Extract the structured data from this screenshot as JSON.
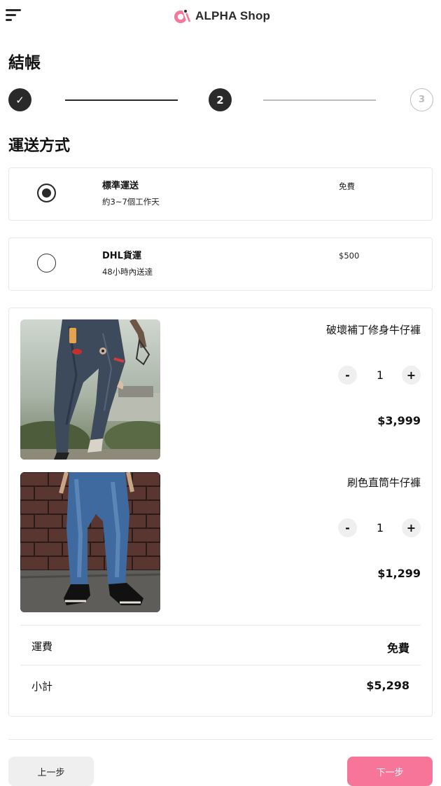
{
  "header": {
    "brand": "ALPHA Shop",
    "menu_icon": "hamburger-menu-icon",
    "logo_icon": "alpha-logo-icon",
    "brand_color": "#f67599"
  },
  "checkout": {
    "title": "結帳",
    "steps": [
      {
        "label": "✓",
        "state": "done"
      },
      {
        "label": "2",
        "state": "current"
      },
      {
        "label": "3",
        "state": "upcoming"
      }
    ]
  },
  "shipping": {
    "title": "運送方式",
    "options": [
      {
        "name": "標準運送",
        "desc": "約3~7個工作天",
        "price": "免費",
        "selected": true
      },
      {
        "name": "DHL貨運",
        "desc": "48小時內送達",
        "price": "$500",
        "selected": false
      }
    ]
  },
  "cart": {
    "items": [
      {
        "name": "破壞補丁修身牛仔褲",
        "qty": "1",
        "price": "$3,999",
        "minus": "-",
        "plus": "+"
      },
      {
        "name": "刷色直筒牛仔褲",
        "qty": "1",
        "price": "$1,299",
        "minus": "-",
        "plus": "+"
      }
    ],
    "shipping_label": "運費",
    "shipping_value": "免費",
    "subtotal_label": "小計",
    "subtotal_value": "$5,298"
  },
  "footer": {
    "prev_label": "上一步",
    "next_label": "下一步"
  }
}
